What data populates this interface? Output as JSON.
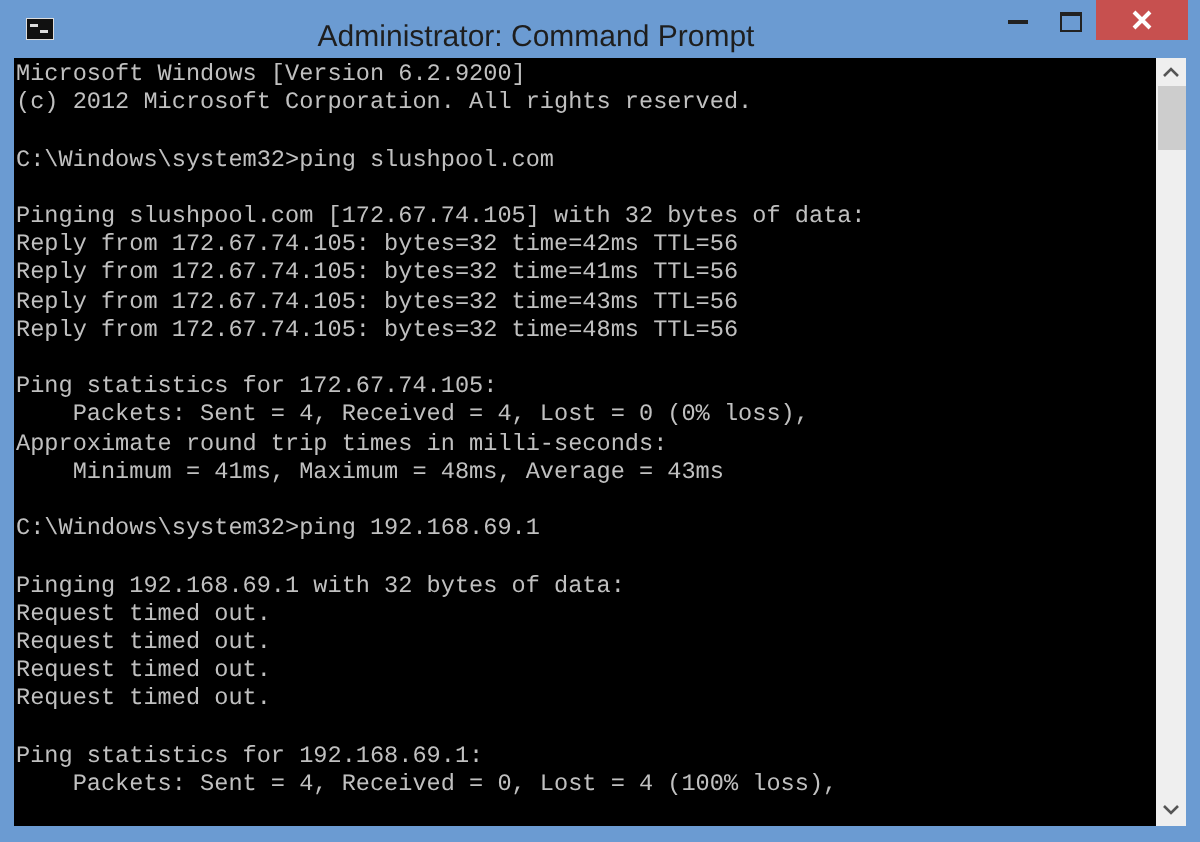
{
  "window": {
    "title": "Administrator: Command Prompt"
  },
  "console": {
    "blocks": [
      [
        "Microsoft Windows [Version 6.2.9200]",
        "(c) 2012 Microsoft Corporation. All rights reserved."
      ],
      [
        "C:\\Windows\\system32>ping slushpool.com"
      ],
      [
        "Pinging slushpool.com [172.67.74.105] with 32 bytes of data:",
        "Reply from 172.67.74.105: bytes=32 time=42ms TTL=56",
        "Reply from 172.67.74.105: bytes=32 time=41ms TTL=56",
        "Reply from 172.67.74.105: bytes=32 time=43ms TTL=56",
        "Reply from 172.67.74.105: bytes=32 time=48ms TTL=56"
      ],
      [
        "Ping statistics for 172.67.74.105:",
        "    Packets: Sent = 4, Received = 4, Lost = 0 (0% loss),",
        "Approximate round trip times in milli-seconds:",
        "    Minimum = 41ms, Maximum = 48ms, Average = 43ms"
      ],
      [
        "C:\\Windows\\system32>ping 192.168.69.1"
      ],
      [
        "Pinging 192.168.69.1 with 32 bytes of data:",
        "Request timed out.",
        "Request timed out.",
        "Request timed out.",
        "Request timed out."
      ],
      [
        "Ping statistics for 192.168.69.1:",
        "    Packets: Sent = 4, Received = 0, Lost = 4 (100% loss),"
      ]
    ]
  }
}
